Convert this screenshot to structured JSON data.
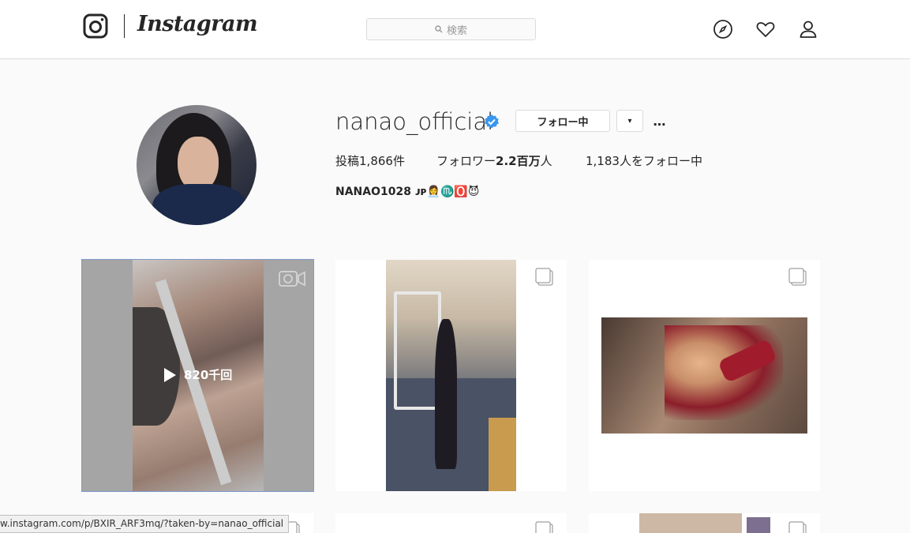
{
  "nav": {
    "brand": "Instagram",
    "search_placeholder": "検索",
    "icons": [
      "instagram-camera-icon",
      "compass-icon",
      "heart-icon",
      "user-icon"
    ]
  },
  "profile": {
    "username": "nanao_official",
    "verified": true,
    "follow_button": "フォロー中",
    "dropdown_label": "▾",
    "more_label": "…",
    "stats": {
      "posts_prefix": "投稿",
      "posts": "1,866",
      "posts_suffix": "件",
      "followers_prefix": "フォロワー",
      "followers": "2.2百万",
      "followers_suffix": "人",
      "following": "1,183",
      "following_suffix": "人をフォロー中"
    },
    "bio": "NANAO1028 ᴊᴘ👩‍💼♏️🅾️😈"
  },
  "posts": [
    {
      "type": "video",
      "views": "820千回"
    },
    {
      "type": "multi"
    },
    {
      "type": "multi"
    },
    {
      "type": "image"
    },
    {
      "type": "multi"
    },
    {
      "type": "multi"
    }
  ],
  "status_bar": {
    "url": "w.instagram.com/p/BXIR_ARF3mq/?taken-by=nanao_official"
  },
  "colors": {
    "background": "#fafafa",
    "border": "#dbdbdb",
    "verified": "#3897f0",
    "text": "#262626"
  }
}
